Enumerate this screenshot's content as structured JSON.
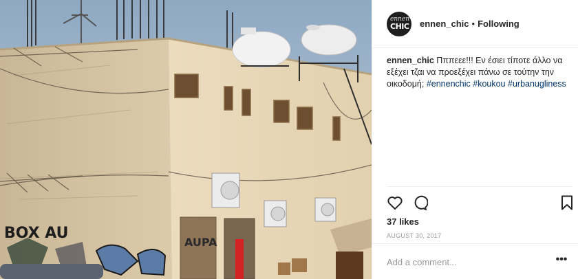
{
  "header": {
    "avatar_text_top": "ennen",
    "avatar_text_bottom": "CHIC",
    "username": "ennen_chic",
    "separator": "•",
    "follow_status": "Following"
  },
  "caption": {
    "username": "ennen_chic",
    "text": "Πππεεε!!! Εν έσιει τίποτε άλλο να εξέχει τζαι να προεξέχει πάνω σε τούτην την οικοδομή;",
    "hashtags": [
      "#ennenchic",
      "#koukou",
      "#urbanugliness"
    ]
  },
  "actions": {
    "like_icon": "heart-icon",
    "comment_icon": "comment-icon",
    "save_icon": "bookmark-icon"
  },
  "likes": "37 likes",
  "date": "AUGUST 30, 2017",
  "comment": {
    "placeholder": "Add a comment...",
    "more_label": "•••"
  },
  "photo": {
    "graffiti_text_1": "BOX AU",
    "graffiti_text_2": "AUPA"
  }
}
